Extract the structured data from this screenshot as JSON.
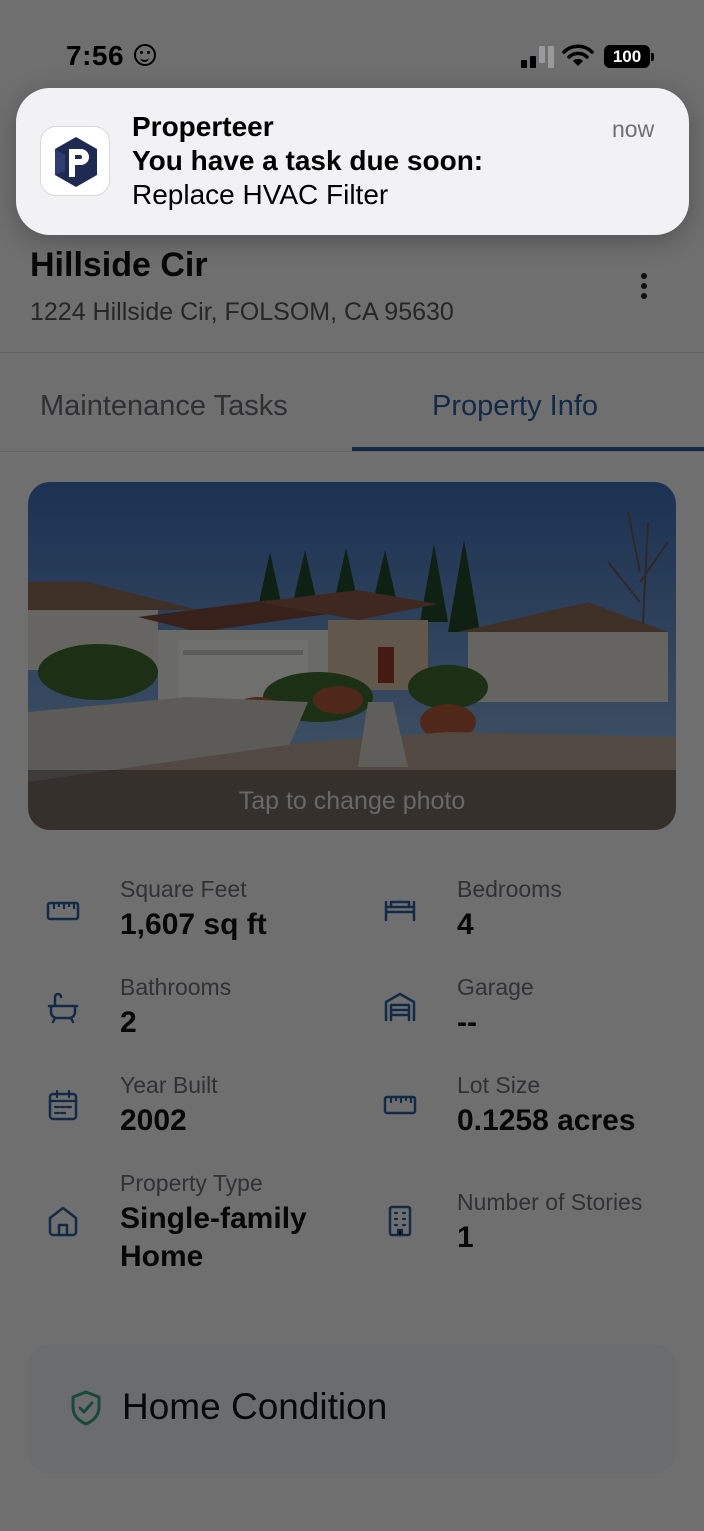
{
  "status_bar": {
    "time": "7:56",
    "battery": "100",
    "time_icon": "smiley-face-icon",
    "icons": [
      "cellular-signal-icon",
      "wifi-icon",
      "battery-icon"
    ]
  },
  "notification": {
    "app_name": "Properteer",
    "time": "now",
    "title": "You have a task due soon:",
    "body": "Replace HVAC Filter",
    "icon": "properteer-logo-icon"
  },
  "property": {
    "name": "Hillside Cir",
    "address": "1224 Hillside Cir, FOLSOM, CA 95630"
  },
  "tabs": [
    {
      "label": "Maintenance Tasks",
      "active": false
    },
    {
      "label": "Property Info",
      "active": true
    }
  ],
  "photo": {
    "caption": "Tap to change photo"
  },
  "details": [
    {
      "label": "Square Feet",
      "value": "1,607 sq ft",
      "icon": "ruler-icon"
    },
    {
      "label": "Bedrooms",
      "value": "4",
      "icon": "bed-icon"
    },
    {
      "label": "Bathrooms",
      "value": "2",
      "icon": "bathtub-icon"
    },
    {
      "label": "Garage",
      "value": "--",
      "icon": "garage-icon"
    },
    {
      "label": "Year Built",
      "value": "2002",
      "icon": "calendar-icon"
    },
    {
      "label": "Lot Size",
      "value": "0.1258 acres",
      "icon": "ruler-icon"
    },
    {
      "label": "Property Type",
      "value": "Single-family Home",
      "value_lines": [
        "Single-family",
        "Home"
      ],
      "icon": "home-icon"
    },
    {
      "label": "Number of Stories",
      "value": "1",
      "icon": "building-icon"
    }
  ],
  "home_condition": {
    "title": "Home Condition",
    "icon": "shield-check-icon"
  },
  "colors": {
    "accent": "#2c5d9e",
    "condition_icon": "#3aa27a",
    "logo": "#1f2a52"
  }
}
